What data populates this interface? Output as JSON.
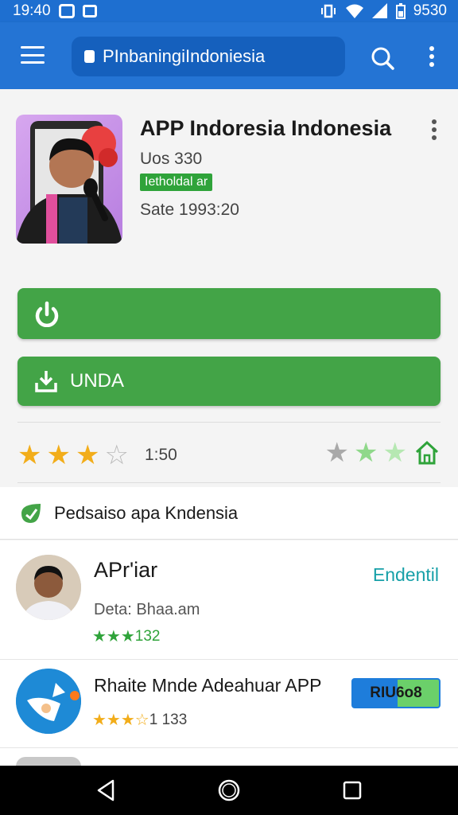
{
  "status_bar": {
    "time": "19:40",
    "right_time": "9530"
  },
  "app_bar": {
    "search_text": "PInbaningiIndoniesia"
  },
  "app": {
    "title": "APP Indoresia Indonesia",
    "subtitle": "Uos 330",
    "tag": "Ietholdal ar",
    "size": "Sate 1993:20"
  },
  "buttons": {
    "primary_label": "",
    "download_label": "UNDA"
  },
  "rating": {
    "count": "1:50",
    "value": 3.5,
    "max": 5
  },
  "section": {
    "title": "Pedsaiso apa Kndensia"
  },
  "list": [
    {
      "title": "APr'iar",
      "action": "Endentil",
      "subtitle": "Deta: Bhaa.am",
      "rating_text": "132",
      "stars": 3
    },
    {
      "title": "Rhaite Mnde Adeahuar  APP",
      "badge": "RIU6o8",
      "rating_text": "1 133",
      "stars": 3.5
    }
  ],
  "colors": {
    "app_bar": "#2474d4",
    "status_bar": "#1e6fd0",
    "primary_green": "#43a447",
    "star_gold": "#f2ad1a",
    "link_teal": "#17a0a8"
  },
  "icons": [
    "menu-icon",
    "lock-icon",
    "search-icon",
    "more-vert-icon",
    "power-icon",
    "download-icon",
    "home-outline-icon",
    "section-badge-icon",
    "back-icon",
    "home-icon",
    "recents-icon"
  ]
}
